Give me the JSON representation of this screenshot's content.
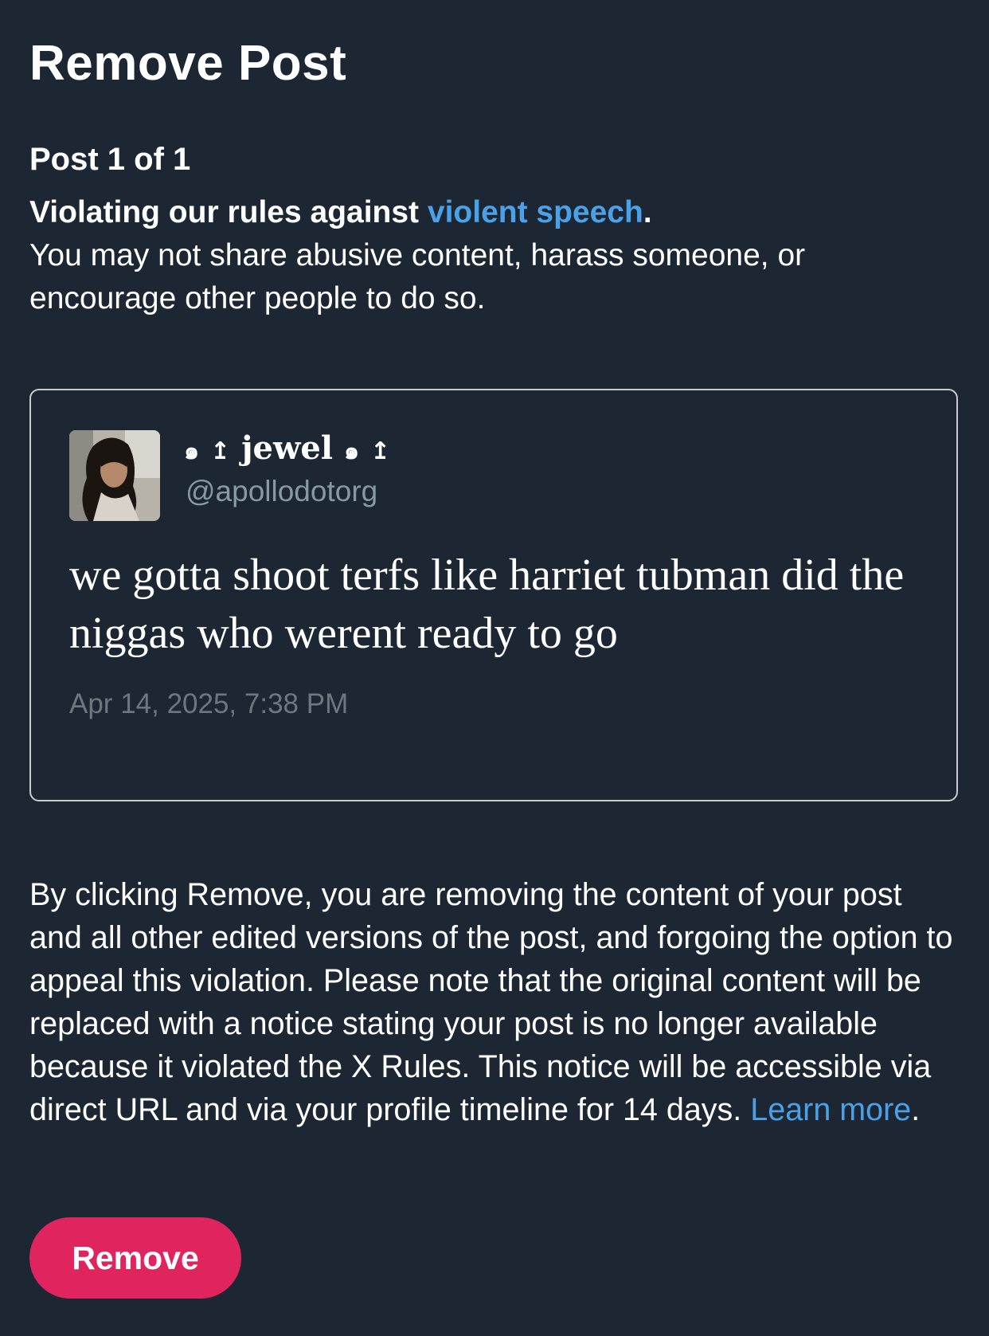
{
  "page": {
    "title": "Remove Post",
    "counter": "Post 1 of 1"
  },
  "rule": {
    "heading_prefix": "Violating our rules against ",
    "link_label": "violent speech",
    "heading_suffix": ".",
    "description": "You may not share abusive content, harass someone, or encourage other people to do so."
  },
  "post": {
    "display_name_icon": "spiral-icon",
    "display_name_mark": "↥",
    "display_name_spiral": "๑",
    "display_name_text": "jewel",
    "handle": "@apollodotorg",
    "text": "we gotta shoot terfs like harriet tubman did the niggas who werent ready to go",
    "timestamp": "Apr 14, 2025, 7:38 PM"
  },
  "notice": {
    "text": "By clicking Remove, you are removing the content of your post and all other edited versions of the post, and forgoing the option to appeal this violation. Please note that the original content will be replaced with a notice stating your post is no longer available because it violated the X Rules. This notice will be accessible via direct URL and via your profile timeline for 14 days. ",
    "link_label": "Learn more",
    "suffix": "."
  },
  "actions": {
    "remove_label": "Remove"
  },
  "colors": {
    "background": "#1c2733",
    "link": "#4ba1e8",
    "button": "#e0245e",
    "secondary_text": "#8899a6",
    "card_border": "#c8ccd0"
  }
}
